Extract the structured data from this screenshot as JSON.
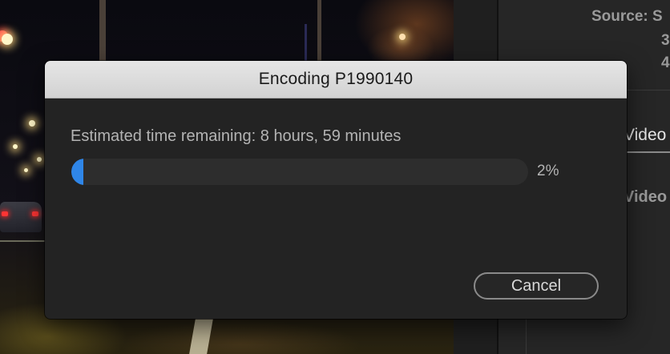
{
  "dialog": {
    "title": "Encoding P1990140",
    "status_text": "Estimated time remaining: 8 hours, 59 minutes",
    "progress": {
      "fraction": 0.02,
      "label": "2%",
      "fill_color": "#2f86e8"
    },
    "cancel_label": "Cancel"
  },
  "side_panel": {
    "source_label": "Source: S",
    "digits": [
      "3",
      "4"
    ],
    "tab_label": "Video",
    "section_label": "Video"
  },
  "background": {
    "description_icon": "video-preview"
  }
}
